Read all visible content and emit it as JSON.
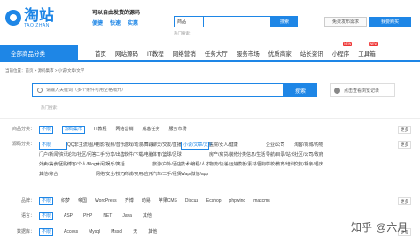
{
  "logo": {
    "cn": "淘站",
    "en": "TAO ZHAN"
  },
  "slogan": {
    "top": "可以自由发货的源码",
    "b1": "便捷",
    "b2": "快速",
    "b3": "实惠"
  },
  "top_search": {
    "select": "商品",
    "placeholder": "",
    "button": "搜索",
    "hot": "热门搜索："
  },
  "header_buttons": {
    "publish": "免费发布需求",
    "buy": "我要购买"
  },
  "nav": {
    "category": "全部商品分类",
    "items": [
      {
        "label": "首页"
      },
      {
        "label": "网站源码"
      },
      {
        "label": "IT教程"
      },
      {
        "label": "网络营销"
      },
      {
        "label": "任务大厅"
      },
      {
        "label": "服务市场"
      },
      {
        "label": "优质商家"
      },
      {
        "label": "站长资讯"
      },
      {
        "label": "小程序",
        "badge": "NEW"
      },
      {
        "label": "工具箱",
        "badge": "NEW"
      }
    ]
  },
  "breadcrumb": "当前位置：首页 > 源码集市 > 小说/文章/文学",
  "search": {
    "placeholder": "请输入关键词（多个条件可用空格隔开）",
    "button": "搜索",
    "history": "点击查看浏览记录",
    "hot": "热门搜索："
  },
  "filters": {
    "category": {
      "label": "商品分类：",
      "options": [
        "不限",
        "源码集市",
        "IT教程",
        "网络营销",
        "威客任务",
        "服务市场"
      ],
      "selected": "源码集市",
      "more": "更多"
    },
    "source": {
      "label": "源码分类：",
      "options": [
        "不限",
        "QQ非主流/图片",
        "电影/视频/音乐",
        "游戏/动漫/舞蹈",
        "聊天/交友/直播",
        "小说/文章/文学",
        "医院/女人/健康",
        "",
        "企业/公司",
        "淘客/商城/购物",
        "门户/新闻/资讯",
        "论坛/社区/问答",
        "二手/分享/出售",
        "软件/下载/电脑",
        "体育/篮球/足球",
        "",
        "房产/房贷/装修",
        "分类信息/生活",
        "导航/目录/站长",
        "社区/公司/政府",
        "外卖/美食/团购",
        "博客/个人/Blog",
        "休闲/娱乐/笑话",
        "",
        "旅游/户外/酒店",
        "技术/编程/人才",
        "物流/快递/运输",
        "模板/素材/图标",
        "学校/教育/培训",
        "交友/相亲/婚庆",
        "其他/综合",
        "",
        "网络/安全/技巧",
        "商城/实用/应用",
        "汽车/二手/租赁",
        "Wap/微信/app",
        "",
        "",
        ""
      ],
      "selected": "小说/文章/文学",
      "more": "更多"
    },
    "brand": {
      "label": "品牌：",
      "options": [
        "不限",
        "织梦",
        "帝国",
        "WordPress",
        "齐博",
        "动易",
        "苹果CMS",
        "Discuz",
        "Ecshop",
        "phpwind",
        "maxcms"
      ],
      "more": "更多"
    },
    "lang": {
      "label": "语言：",
      "options": [
        "不限",
        "ASP",
        "PHP",
        "NET",
        "Java",
        "其他"
      ]
    },
    "db": {
      "label": "数据库：",
      "options": [
        "不限",
        "Access",
        "Mysql",
        "Mssql",
        "无",
        "其他"
      ],
      "more": "更多"
    }
  },
  "watermark": {
    "brand": "知乎",
    "author": "@六月"
  }
}
